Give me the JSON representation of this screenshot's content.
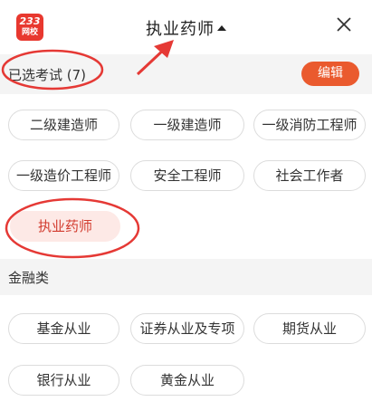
{
  "header": {
    "logo_top": "233",
    "logo_bottom": "网校",
    "title": "执业药师",
    "caret_icon": "caret-up-icon",
    "close_icon": "close-icon"
  },
  "selected_section": {
    "label": "已选考试 (7)",
    "edit_label": "编辑"
  },
  "selected_exams": [
    "二级建造师",
    "一级建造师",
    "一级消防工程师",
    "一级造价工程师",
    "安全工程师",
    "社会工作者",
    "执业药师"
  ],
  "finance_section": {
    "label": "金融类"
  },
  "finance_exams": [
    "基金从业",
    "证券从业及专项",
    "期货从业",
    "银行从业",
    "黄金从业"
  ],
  "colors": {
    "accent": "#ea5a2e",
    "logo_red": "#e8382f",
    "selected_chip_bg": "#fde9e6",
    "annotation": "#e53935",
    "section_bg": "#f4f4f4"
  }
}
